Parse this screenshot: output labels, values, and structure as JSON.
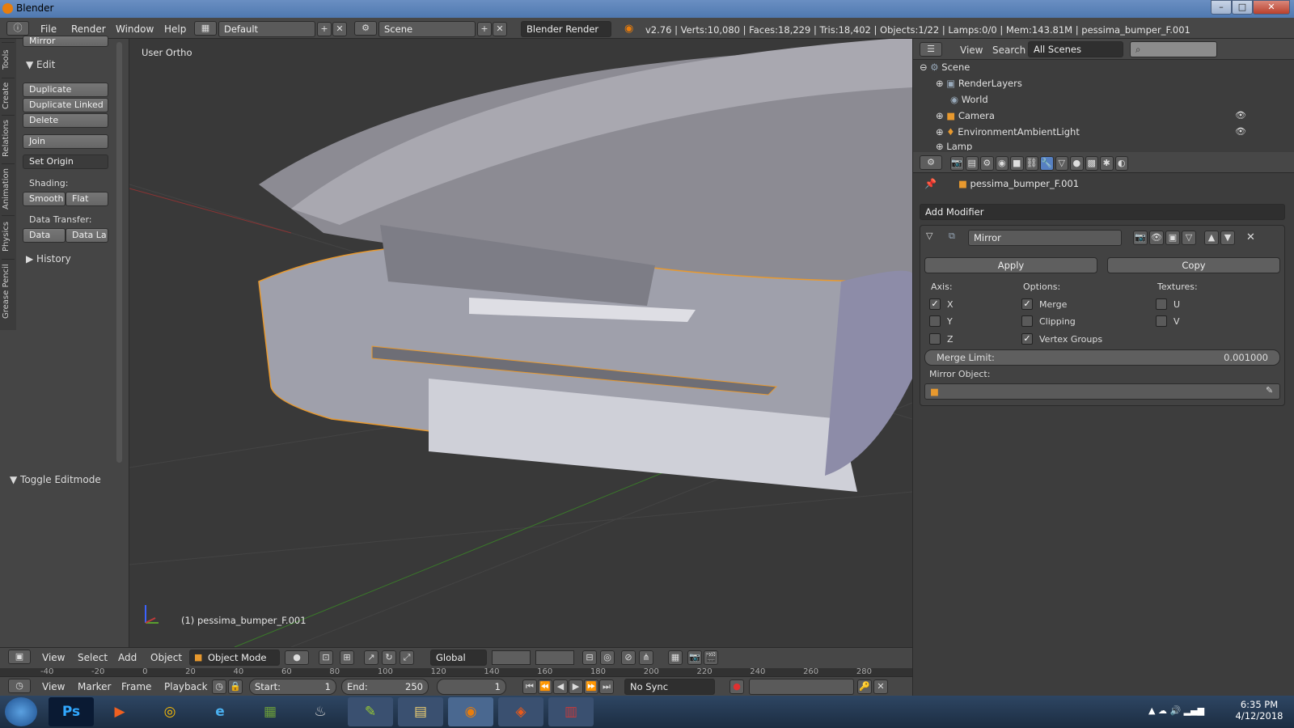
{
  "window": {
    "title": "Blender",
    "minimize": "–",
    "maximize": "□",
    "close": "✕"
  },
  "infobar": {
    "menus": [
      "File",
      "Render",
      "Window",
      "Help"
    ],
    "layout": "Default",
    "scene": "Scene",
    "engine": "Blender Render",
    "stats": "v2.76 | Verts:10,080 | Faces:18,229 | Tris:18,402 | Objects:1/22 | Lamps:0/0 | Mem:143.81M | pessima_bumper_F.001"
  },
  "vtabs": [
    "Tools",
    "Create",
    "Relations",
    "Animation",
    "Physics",
    "Grease Pencil"
  ],
  "toolshelf": {
    "mirror": "Mirror",
    "edit_header": "Edit",
    "duplicate": "Duplicate",
    "duplicate_linked": "Duplicate Linked",
    "delete": "Delete",
    "join": "Join",
    "set_origin": "Set Origin",
    "shading": "Shading:",
    "smooth": "Smooth",
    "flat": "Flat",
    "data_transfer": "Data Transfer:",
    "data": "Data",
    "data_la": "Data La",
    "history": "History",
    "toggle_editmode": "Toggle Editmode"
  },
  "viewport": {
    "view_label": "User Ortho",
    "object_label": "(1) pessima_bumper_F.001"
  },
  "outliner": {
    "view": "View",
    "search": "Search",
    "scenes": "All Scenes",
    "items": [
      "Scene",
      "RenderLayers",
      "World",
      "Camera",
      "EnvironmentAmbientLight",
      "Lamp"
    ]
  },
  "properties": {
    "object": "pessima_bumper_F.001",
    "add_modifier": "Add Modifier",
    "modifier_name": "Mirror",
    "apply": "Apply",
    "copy": "Copy",
    "axis": "Axis:",
    "options": "Options:",
    "textures": "Textures:",
    "x": "X",
    "y": "Y",
    "z": "Z",
    "merge": "Merge",
    "clipping": "Clipping",
    "vertex_groups": "Vertex Groups",
    "u": "U",
    "v": "V",
    "merge_limit_label": "Merge Limit:",
    "merge_limit_value": "0.001000",
    "mirror_object": "Mirror Object:"
  },
  "view3d_header": {
    "menus": [
      "View",
      "Select",
      "Add",
      "Object"
    ],
    "mode": "Object Mode",
    "orientation": "Global"
  },
  "ruler": [
    "-40",
    "-20",
    "0",
    "20",
    "40",
    "60",
    "80",
    "100",
    "120",
    "140",
    "160",
    "180",
    "200",
    "220",
    "240",
    "260",
    "280"
  ],
  "timeline": {
    "menus": [
      "View",
      "Marker",
      "Frame",
      "Playback"
    ],
    "start": "Start:",
    "start_val": "1",
    "end": "End:",
    "end_val": "250",
    "current": "1",
    "sync": "No Sync"
  },
  "taskbar": {
    "time": "6:35 PM",
    "date": "4/12/2018",
    "apps": [
      "Ps",
      "▶",
      "◎",
      "e",
      "▦",
      "♨",
      "✎",
      "▤",
      "◉",
      "◈",
      "▥"
    ]
  }
}
